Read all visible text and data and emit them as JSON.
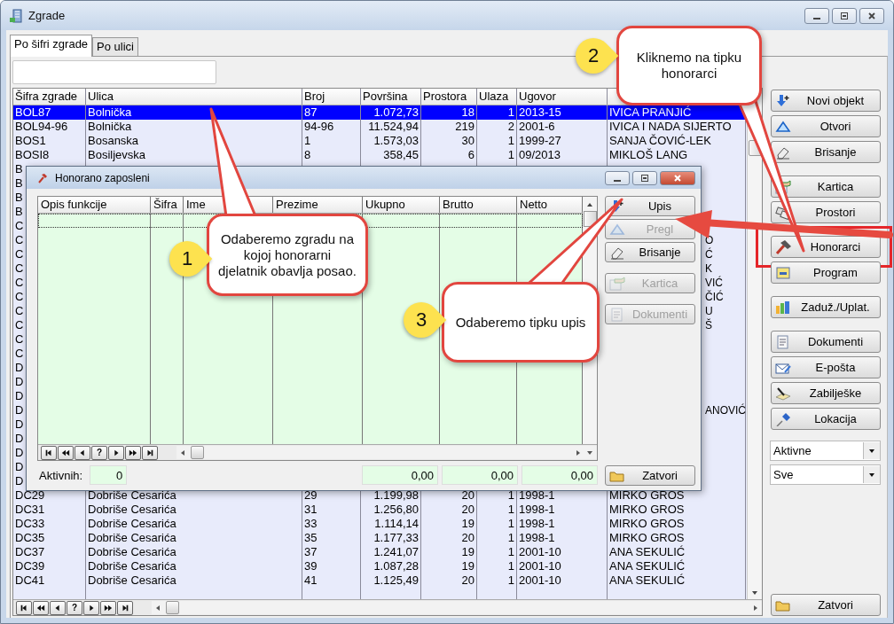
{
  "window": {
    "title": "Zgrade"
  },
  "tabs": [
    {
      "label": "Po šifri zgrade",
      "selected": true
    },
    {
      "label": "Po ulici",
      "selected": false
    }
  ],
  "table": {
    "columns": [
      "Šifra zgrade",
      "Ulica",
      "Broj",
      "Površina",
      "Prostora",
      "Ulaza",
      "Ugovor"
    ],
    "rows": [
      {
        "kind": "full",
        "selected": true,
        "cells": [
          "BOL87",
          "Bolnička",
          "87",
          "1.072,73",
          "18",
          "1",
          "2013-15",
          "IVICA PRANJIĆ"
        ]
      },
      {
        "kind": "full",
        "selected": false,
        "cells": [
          "BOL94-96",
          "Bolnička",
          "94-96",
          "11.524,94",
          "219",
          "2",
          "2001-6",
          "IVICA I NADA SIJERTO"
        ]
      },
      {
        "kind": "full",
        "selected": false,
        "cells": [
          "BOS1",
          "Bosanska",
          "1",
          "1.573,03",
          "30",
          "1",
          "1999-27",
          "SANJA ČOVIĆ-LEK"
        ]
      },
      {
        "kind": "full",
        "selected": false,
        "cells": [
          "BOSI8",
          "Bosiljevska",
          "8",
          "358,45",
          "6",
          "1",
          "09/2013",
          "MIKLOŠ LANG"
        ]
      },
      {
        "kind": "covered",
        "code": "B"
      },
      {
        "kind": "covered",
        "code": "B"
      },
      {
        "kind": "covered",
        "code": "B"
      },
      {
        "kind": "covered",
        "code": "B"
      },
      {
        "kind": "covered",
        "code": "C"
      },
      {
        "kind": "covered",
        "code": "C",
        "tail": "O"
      },
      {
        "kind": "covered",
        "code": "C",
        "tail": "Ć"
      },
      {
        "kind": "covered",
        "code": "C",
        "tail": "K"
      },
      {
        "kind": "covered",
        "code": "C",
        "tail": "VIĆ"
      },
      {
        "kind": "covered",
        "code": "C",
        "tail": "ČIĆ"
      },
      {
        "kind": "covered",
        "code": "C",
        "tail": "U"
      },
      {
        "kind": "covered",
        "code": "C",
        "tail": "Š"
      },
      {
        "kind": "covered",
        "code": "C"
      },
      {
        "kind": "covered",
        "code": "C"
      },
      {
        "kind": "covered",
        "code": "D"
      },
      {
        "kind": "covered",
        "code": "D"
      },
      {
        "kind": "covered",
        "code": "D"
      },
      {
        "kind": "covered",
        "code": "D",
        "tail": "ANOVIĆ"
      },
      {
        "kind": "covered",
        "code": "D"
      },
      {
        "kind": "covered",
        "code": "D"
      },
      {
        "kind": "covered",
        "code": "D"
      },
      {
        "kind": "covered",
        "code": "D"
      },
      {
        "kind": "covered",
        "code": "D"
      },
      {
        "kind": "full",
        "selected": false,
        "cells": [
          "DC29",
          "Dobriše Cesarića",
          "29",
          "1.199,98",
          "20",
          "1",
          "1998-1",
          "MIRKO GROS"
        ]
      },
      {
        "kind": "full",
        "selected": false,
        "cells": [
          "DC31",
          "Dobriše Cesarića",
          "31",
          "1.256,80",
          "20",
          "1",
          "1998-1",
          "MIRKO GROS"
        ]
      },
      {
        "kind": "full",
        "selected": false,
        "cells": [
          "DC33",
          "Dobriše Cesarića",
          "33",
          "1.114,14",
          "19",
          "1",
          "1998-1",
          "MIRKO GROS"
        ]
      },
      {
        "kind": "full",
        "selected": false,
        "cells": [
          "DC35",
          "Dobriše Cesarića",
          "35",
          "1.177,33",
          "20",
          "1",
          "1998-1",
          "MIRKO GROS"
        ]
      },
      {
        "kind": "full",
        "selected": false,
        "cells": [
          "DC37",
          "Dobriše Cesarića",
          "37",
          "1.241,07",
          "19",
          "1",
          "2001-10",
          "ANA SEKULIĆ"
        ]
      },
      {
        "kind": "full",
        "selected": false,
        "cells": [
          "DC39",
          "Dobriše Cesarića",
          "39",
          "1.087,28",
          "19",
          "1",
          "2001-10",
          "ANA SEKULIĆ"
        ]
      },
      {
        "kind": "full",
        "selected": false,
        "cells": [
          "DC41",
          "Dobriše Cesarića",
          "41",
          "1.125,49",
          "20",
          "1",
          "2001-10",
          "ANA SEKULIĆ"
        ]
      }
    ]
  },
  "nav": [
    {
      "kind": "first"
    },
    {
      "kind": "prev_page"
    },
    {
      "kind": "prev"
    },
    {
      "kind": "help",
      "label": "?"
    },
    {
      "kind": "next"
    },
    {
      "kind": "next_page"
    },
    {
      "kind": "last"
    }
  ],
  "side_buttons": [
    {
      "label": "Novi objekt",
      "kind": "new",
      "highlighted": false
    },
    {
      "label": "Otvori",
      "kind": "open",
      "highlighted": false
    },
    {
      "label": "Brisanje",
      "kind": "delete",
      "highlighted": false
    },
    {
      "label": "Kartica",
      "kind": "card",
      "highlighted": false
    },
    {
      "label": "Prostori",
      "kind": "spaces",
      "highlighted": false
    },
    {
      "label": "Honorarci",
      "kind": "hammer",
      "highlighted": true
    },
    {
      "label": "Program",
      "kind": "program",
      "highlighted": false
    },
    {
      "label": "Zaduž./Uplat.",
      "kind": "chart",
      "highlighted": false
    },
    {
      "label": "Dokumenti",
      "kind": "docs",
      "highlighted": false
    },
    {
      "label": "E-pošta",
      "kind": "mail",
      "highlighted": false
    },
    {
      "label": "Zabilješke",
      "kind": "note",
      "highlighted": false
    },
    {
      "label": "Lokacija",
      "kind": "pin",
      "highlighted": false
    }
  ],
  "filters": [
    {
      "value": "Aktivne"
    },
    {
      "value": "Sve"
    }
  ],
  "close_button": {
    "label": "Zatvori"
  },
  "dialog": {
    "title": "Honorano zaposleni",
    "columns": [
      "Opis funkcije",
      "Šifra",
      "Ime",
      "Prezime",
      "Ukupno",
      "Brutto",
      "Netto"
    ],
    "nav": [
      {
        "kind": "first"
      },
      {
        "kind": "prev_page"
      },
      {
        "kind": "prev"
      },
      {
        "kind": "help",
        "label": "?"
      },
      {
        "kind": "next"
      },
      {
        "kind": "next_page"
      },
      {
        "kind": "last"
      }
    ],
    "active_label": "Aktivnih:",
    "active_count": "0",
    "totals": [
      "0,00",
      "0,00",
      "0,00"
    ],
    "buttons": [
      {
        "label": "Upis",
        "kind": "new",
        "disabled": false
      },
      {
        "label": "Pregl",
        "kind": "open",
        "disabled": true
      },
      {
        "label": "Brisanje",
        "kind": "delete",
        "disabled": false
      },
      {
        "label": "Kartica",
        "kind": "card",
        "disabled": true
      },
      {
        "label": "Dokumenti",
        "kind": "docs",
        "disabled": true
      }
    ],
    "close_button": {
      "label": "Zatvori"
    }
  },
  "callouts": [
    {
      "number": "1",
      "text": "Odaberemo zgradu na kojoj honorarni djelatnik obavlja posao."
    },
    {
      "number": "2",
      "text": "Kliknemo na tipku honorarci"
    },
    {
      "number": "3",
      "text": "Odaberemo tipku upis"
    }
  ]
}
